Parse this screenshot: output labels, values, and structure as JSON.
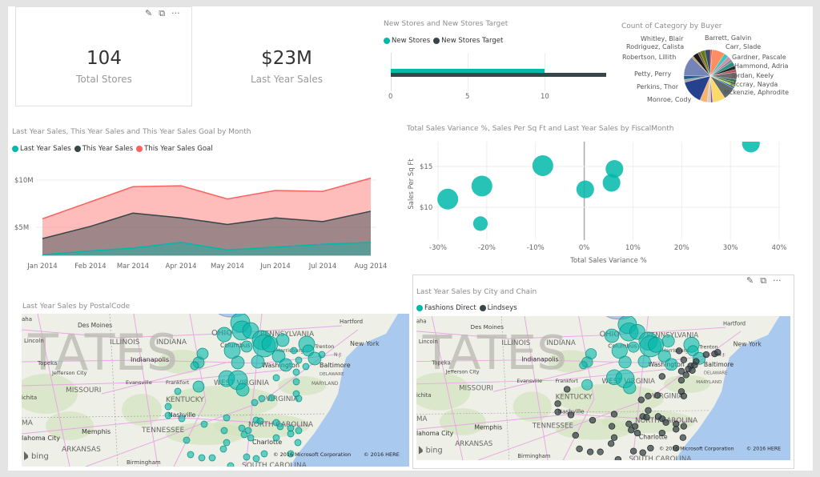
{
  "cards": [
    {
      "value": "104",
      "label": "Total Stores"
    },
    {
      "value": "$23M",
      "label": "Last Year Sales"
    }
  ],
  "tile_icons": [
    "pin-icon",
    "focus-mode-icon",
    "more-options-icon"
  ],
  "tile_icon_glyphs": {
    "pin": "📌",
    "focus": "⧉",
    "more": "···"
  },
  "colors": {
    "teal": "#01b8aa",
    "dark": "#374649",
    "red": "#fd625e",
    "ocean": "#a9c9ef",
    "land": "#eef0e7"
  },
  "chart_data": [
    {
      "id": "new_stores",
      "type": "bar",
      "title": "New Stores and New Stores Target",
      "series": [
        {
          "name": "New Stores",
          "values": [
            10
          ],
          "color": "#01b8aa"
        },
        {
          "name": "New Stores Target",
          "values": [
            14
          ],
          "color": "#374649"
        }
      ],
      "xticks": [
        "0",
        "5",
        "10"
      ],
      "xlim": [
        0,
        14
      ]
    },
    {
      "id": "category_by_buyer",
      "type": "pie",
      "title": "Count of Category by Buyer",
      "slices": [
        {
          "label": "Barrett, Galvin",
          "value": 1,
          "color": "#e8453c"
        },
        {
          "label": "",
          "value": 7,
          "color": "#fd8d62"
        },
        {
          "label": "Carr, Slade",
          "value": 2.5,
          "color": "#3ec6bb"
        },
        {
          "label": "",
          "value": 2,
          "color": "#c98fb4"
        },
        {
          "label": "",
          "value": 1.5,
          "color": "#8b8b8b"
        },
        {
          "label": "Gardner, Pascale",
          "value": 2.5,
          "color": "#2f8f86"
        },
        {
          "label": "",
          "value": 2,
          "color": "#1e2a2c"
        },
        {
          "label": "Hammond, Adria",
          "value": 1.5,
          "color": "#b84b55"
        },
        {
          "label": "",
          "value": 4,
          "color": "#6c6c6c"
        },
        {
          "label": "Jordan, Keely",
          "value": 1.5,
          "color": "#2b6c5a"
        },
        {
          "label": "",
          "value": 1.5,
          "color": "#5a7f3a"
        },
        {
          "label": "Mccray, Nayda",
          "value": 1,
          "color": "#a7d82a"
        },
        {
          "label": "",
          "value": 1,
          "color": "#2f5fb3"
        },
        {
          "label": "Mckenzie, Aphrodite",
          "value": 7,
          "color": "#5f6b6d"
        },
        {
          "label": "",
          "value": 7,
          "color": "#fbd96a"
        },
        {
          "label": "",
          "value": 1,
          "color": "#7d4ba3"
        },
        {
          "label": "Monroe, Cody",
          "value": 2,
          "color": "#d9d0c4"
        },
        {
          "label": "",
          "value": 4,
          "color": "#f4b36e"
        },
        {
          "label": "Perkins, Thor",
          "value": 13,
          "color": "#26418d"
        },
        {
          "label": "",
          "value": 1.5,
          "color": "#a4a4a4"
        },
        {
          "label": "Petty, Perry",
          "value": 2,
          "color": "#1f5f8a"
        },
        {
          "label": "Robertson, Lillith",
          "value": 11,
          "color": "#7483b8"
        },
        {
          "label": "",
          "value": 1,
          "color": "#c4a35a"
        },
        {
          "label": "Rodriguez, Calista",
          "value": 3,
          "color": "#1a1a1a"
        },
        {
          "label": "",
          "value": 1.5,
          "color": "#7c5a3c"
        },
        {
          "label": "Whitley, Blair",
          "value": 2.5,
          "color": "#5e7c14"
        },
        {
          "label": "",
          "value": 3,
          "color": "#3c4a6a"
        }
      ]
    },
    {
      "id": "sales_by_month",
      "type": "area",
      "title": "Last Year Sales, This Year Sales and This Year Sales Goal by Month",
      "categories": [
        "Jan 2014",
        "Feb 2014",
        "Mar 2014",
        "Apr 2014",
        "May 2014",
        "Jun 2014",
        "Jul 2014",
        "Aug 2014"
      ],
      "series": [
        {
          "name": "This Year Sales Goal",
          "color": "#fd625e",
          "values": [
            5.9,
            7.7,
            9.3,
            9.4,
            8.0,
            8.9,
            8.8,
            10.2
          ]
        },
        {
          "name": "This Year Sales",
          "color": "#374649",
          "values": [
            3.8,
            5.1,
            6.5,
            6.0,
            5.3,
            6.0,
            5.6,
            6.7
          ]
        },
        {
          "name": "Last Year Sales",
          "color": "#01b8aa",
          "values": [
            2.1,
            2.5,
            2.8,
            3.4,
            2.6,
            2.9,
            3.2,
            3.4
          ]
        }
      ],
      "legend_order": [
        "Last Year Sales",
        "This Year Sales",
        "This Year Sales Goal"
      ],
      "yunit": "$M",
      "yticks": [
        {
          "value": 10,
          "label": "$10M"
        },
        {
          "value": 5,
          "label": "$5M"
        }
      ],
      "ylim": [
        2,
        11.5
      ],
      "grid": true,
      "legend": "top-left"
    },
    {
      "id": "variance_scatter",
      "type": "scatter",
      "title": "Total Sales Variance %, Sales Per Sq Ft and Last Year Sales by FiscalMonth",
      "xlabel": "Total Sales Variance %",
      "ylabel": "Sales Per Sq Ft",
      "xlim": [
        -30,
        40
      ],
      "ylim": [
        6,
        18
      ],
      "xticks": [
        "-30%",
        "-20%",
        "-10%",
        "0%",
        "10%",
        "20%",
        "30%",
        "40%"
      ],
      "yticks": [
        {
          "value": 15,
          "label": "$15"
        },
        {
          "value": 10,
          "label": "$10"
        }
      ],
      "grid": true,
      "points": [
        {
          "x": -28,
          "y": 11.0,
          "size": 1.0
        },
        {
          "x": -21,
          "y": 12.6,
          "size": 1.0
        },
        {
          "x": -21.3,
          "y": 8.0,
          "size": 0.7
        },
        {
          "x": -8.5,
          "y": 15.1,
          "size": 1.0
        },
        {
          "x": 0.2,
          "y": 12.2,
          "size": 0.85
        },
        {
          "x": 5.6,
          "y": 13.0,
          "size": 0.85
        },
        {
          "x": 6.2,
          "y": 14.7,
          "size": 0.85
        },
        {
          "x": 34.2,
          "y": 17.8,
          "size": 0.85
        }
      ]
    }
  ],
  "maps": {
    "postal": {
      "title": "Last Year Sales by PostalCode"
    },
    "city_chain": {
      "title": "Last Year Sales by City and Chain",
      "legend": [
        "Fashions Direct",
        "Lindseys"
      ]
    },
    "watermark": "TATES",
    "bing_logo": "bing",
    "copyright_ms": "© 2016 Microsoft Corporation",
    "copyright_here": "© 2016 HERE",
    "labels": {
      "des_moines": "Des Moines",
      "lincoln": "Lincoln",
      "illinois": "ILLINOIS",
      "indiana": "INDIANA",
      "ohio": "OHIO",
      "pennsylvania": "PENNSYLVANIA",
      "new_york": "New York",
      "hartford": "Hartford",
      "trenton": "Trenton",
      "columbus": "Columbus",
      "harrisburg": "Harrisburg",
      "nj": "N.J.",
      "topeka": "Topeka",
      "indianapolis": "Indianapolis",
      "washington": "Washington",
      "baltimore": "Baltimore",
      "jefferson_city": "Jefferson City",
      "delaware": "DELAWARE",
      "evansville": "Evansville",
      "frankfort": "Frankfort",
      "west_virginia": "WEST VIRGINIA",
      "maryland": "MARYLAND",
      "missouri": "MISSOURI",
      "wichita": "ichita",
      "kentucky": "KENTUCKY",
      "virginia": "VIRGINIA",
      "nashville": "Nashville",
      "tennessee": "TENNESSEE",
      "north_carolina": "NORTH CAROLINA",
      "memphis": "Memphis",
      "oklahoma_city": "lahoma City",
      "arkansas": "ARKANSAS",
      "charlotte": "Charlotte",
      "birmingham": "Birmingham",
      "south_carolina": "SOUTH CAROLINA",
      "omaha": "aha",
      "oma": "MA"
    }
  }
}
